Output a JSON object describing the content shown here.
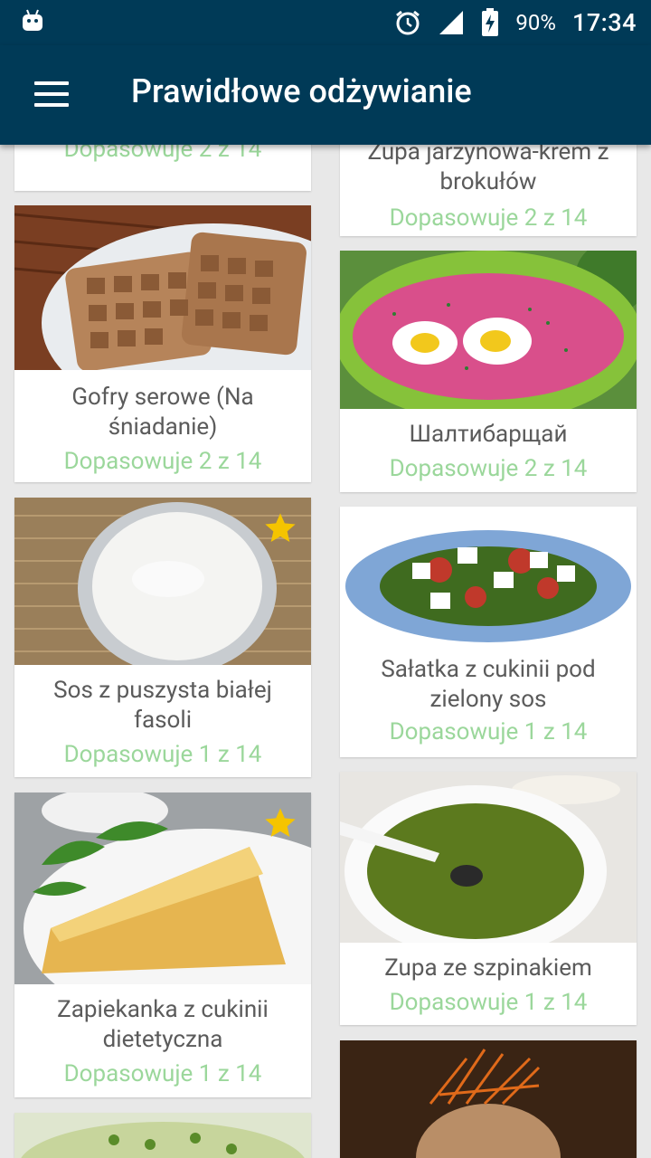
{
  "status": {
    "battery": "90%",
    "time": "17:34"
  },
  "app": {
    "title": "Prawidłowe odżywianie"
  },
  "cards": [
    {
      "title": "",
      "match": "Dopasowuje 2 z 14"
    },
    {
      "title": "Zupa jarzynowa-krem z brokułów",
      "match": "Dopasowuje 2 z 14"
    },
    {
      "title": "Gofry serowe (Na śniadanie)",
      "match": "Dopasowuje 2 z 14"
    },
    {
      "title": "Шалтибарщай",
      "match": "Dopasowuje 2 z 14"
    },
    {
      "title": "Sos z puszysta białej fasoli",
      "match": "Dopasowuje 1 z 14"
    },
    {
      "title": "Sałatka z cukinii pod zielony sos",
      "match": "Dopasowuje 1 z 14"
    },
    {
      "title": "Zapiekanka z cukinii dietetyczna",
      "match": "Dopasowuje 1 z 14"
    },
    {
      "title": "Zupa ze szpinakiem",
      "match": "Dopasowuje 1 z 14"
    }
  ],
  "icons": {
    "menu": "hamburger-icon",
    "star": "star-icon",
    "alarm": "alarm-icon",
    "signal": "signal-icon",
    "battery": "battery-charging-icon",
    "android": "android-icon"
  },
  "colors": {
    "primary": "#003a57",
    "match": "#9bd79b",
    "star": "#f5c400"
  }
}
